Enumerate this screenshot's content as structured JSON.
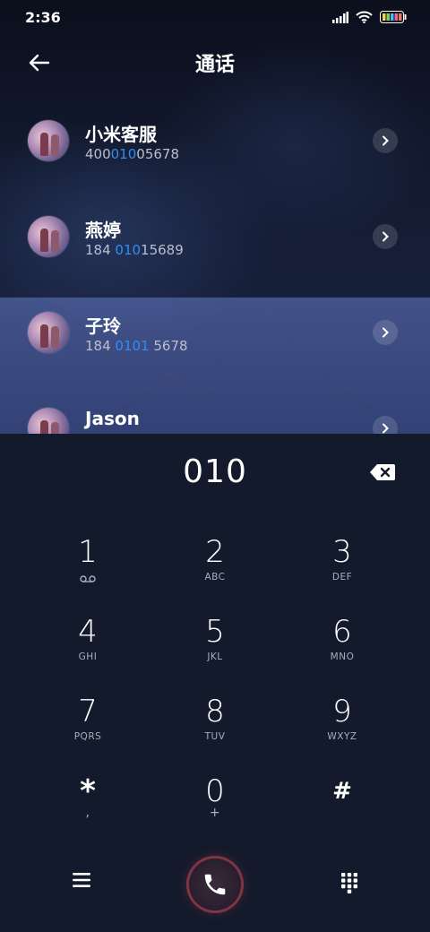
{
  "status_bar": {
    "time": "2:36"
  },
  "header": {
    "title": "通话"
  },
  "contacts": [
    {
      "name": "小米客服",
      "num_pre": "400",
      "num_hl": "010",
      "num_post": "05678"
    },
    {
      "name": "燕婷",
      "num_pre": "184 ",
      "num_hl": "010",
      "num_post": "15689"
    },
    {
      "name": "子玲",
      "num_pre": "184 ",
      "num_hl": "0101",
      "num_post": " 5678"
    },
    {
      "name": "Jason",
      "num_pre": "",
      "num_hl": "",
      "num_post": ""
    }
  ],
  "dialer": {
    "input": "010",
    "keys": [
      {
        "num": "1",
        "sub": "voicemail-icon"
      },
      {
        "num": "2",
        "sub": "ABC"
      },
      {
        "num": "3",
        "sub": "DEF"
      },
      {
        "num": "4",
        "sub": "GHI"
      },
      {
        "num": "5",
        "sub": "JKL"
      },
      {
        "num": "6",
        "sub": "MNO"
      },
      {
        "num": "7",
        "sub": "PQRS"
      },
      {
        "num": "8",
        "sub": "TUV"
      },
      {
        "num": "9",
        "sub": "WXYZ"
      },
      {
        "num": "*",
        "sub": ","
      },
      {
        "num": "0",
        "sub": "+"
      },
      {
        "num": "#",
        "sub": ""
      }
    ]
  },
  "colors": {
    "highlight": "#2f8ef4",
    "dialer_bg": "#131a2b",
    "call_ring": "#c84650"
  },
  "icons": [
    "back-arrow-icon",
    "chevron-right-icon",
    "backspace-icon",
    "menu-icon",
    "phone-icon",
    "dialpad-icon",
    "signal-icon",
    "wifi-icon",
    "battery-icon"
  ]
}
